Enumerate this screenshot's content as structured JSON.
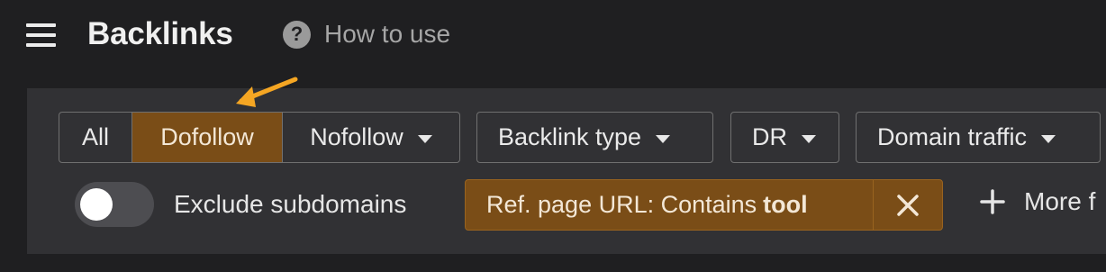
{
  "header": {
    "menu_icon": "hamburger-icon",
    "title": "Backlinks",
    "help_icon": "question-circle-icon",
    "help_label": "How to use"
  },
  "filters": {
    "link_type_group": {
      "all_label": "All",
      "dofollow_label": "Dofollow",
      "nofollow_label": "Nofollow",
      "selected": "Dofollow"
    },
    "backlink_type_label": "Backlink type",
    "dr_label": "DR",
    "domain_traffic_label": "Domain traffic",
    "exclude_subdomains": {
      "label": "Exclude subdomains",
      "enabled": false
    },
    "active_chip": {
      "prefix": "Ref. page URL: Contains",
      "value": "tool",
      "remove_icon": "close-icon"
    },
    "more_filters_label": "More f"
  },
  "annotation": {
    "icon": "pointer-arrow-icon",
    "color": "#f5a623"
  },
  "colors": {
    "background": "#1f1f21",
    "panel": "#313134",
    "active_accent": "#7a4d17",
    "border": "#707070"
  }
}
